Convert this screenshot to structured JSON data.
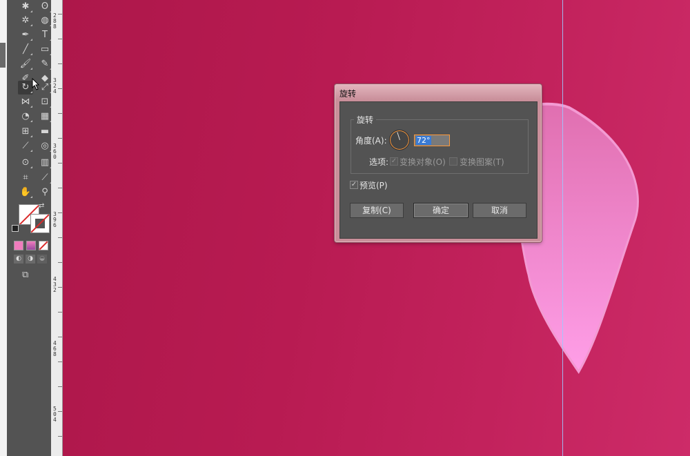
{
  "ruler": {
    "labels": [
      "288",
      "324",
      "360",
      "396",
      "432",
      "468",
      "504"
    ]
  },
  "dialog": {
    "title": "旋转",
    "group_label": "旋转",
    "angle_label": "角度(A):",
    "angle_value": "72°",
    "options_label": "选项:",
    "transform_objects_label": "变换对象(O)",
    "transform_objects_checked": true,
    "transform_patterns_label": "变换图案(T)",
    "transform_patterns_checked": false,
    "preview_label": "预览(P)",
    "preview_checked": true,
    "copy_button": "复制(C)",
    "ok_button": "确定",
    "cancel_button": "取消"
  },
  "toolbar": {
    "type_tool_glyph": "T"
  },
  "colors": {
    "canvas_start": "#ad174a",
    "canvas_end": "#cd2b68",
    "petal_top": "#e874b8",
    "petal_bottom": "#ff9fe8",
    "accent": "#ff9a3c"
  }
}
